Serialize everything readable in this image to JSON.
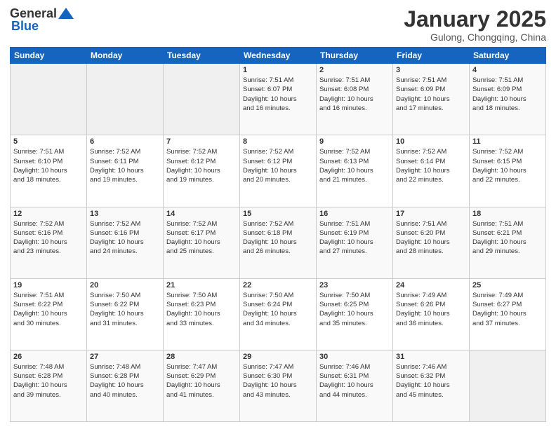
{
  "header": {
    "logo_general": "General",
    "logo_blue": "Blue",
    "month_title": "January 2025",
    "location": "Gulong, Chongqing, China"
  },
  "days_of_week": [
    "Sunday",
    "Monday",
    "Tuesday",
    "Wednesday",
    "Thursday",
    "Friday",
    "Saturday"
  ],
  "weeks": [
    [
      {
        "num": "",
        "info": ""
      },
      {
        "num": "",
        "info": ""
      },
      {
        "num": "",
        "info": ""
      },
      {
        "num": "1",
        "info": "Sunrise: 7:51 AM\nSunset: 6:07 PM\nDaylight: 10 hours\nand 16 minutes."
      },
      {
        "num": "2",
        "info": "Sunrise: 7:51 AM\nSunset: 6:08 PM\nDaylight: 10 hours\nand 16 minutes."
      },
      {
        "num": "3",
        "info": "Sunrise: 7:51 AM\nSunset: 6:09 PM\nDaylight: 10 hours\nand 17 minutes."
      },
      {
        "num": "4",
        "info": "Sunrise: 7:51 AM\nSunset: 6:09 PM\nDaylight: 10 hours\nand 18 minutes."
      }
    ],
    [
      {
        "num": "5",
        "info": "Sunrise: 7:51 AM\nSunset: 6:10 PM\nDaylight: 10 hours\nand 18 minutes."
      },
      {
        "num": "6",
        "info": "Sunrise: 7:52 AM\nSunset: 6:11 PM\nDaylight: 10 hours\nand 19 minutes."
      },
      {
        "num": "7",
        "info": "Sunrise: 7:52 AM\nSunset: 6:12 PM\nDaylight: 10 hours\nand 19 minutes."
      },
      {
        "num": "8",
        "info": "Sunrise: 7:52 AM\nSunset: 6:12 PM\nDaylight: 10 hours\nand 20 minutes."
      },
      {
        "num": "9",
        "info": "Sunrise: 7:52 AM\nSunset: 6:13 PM\nDaylight: 10 hours\nand 21 minutes."
      },
      {
        "num": "10",
        "info": "Sunrise: 7:52 AM\nSunset: 6:14 PM\nDaylight: 10 hours\nand 22 minutes."
      },
      {
        "num": "11",
        "info": "Sunrise: 7:52 AM\nSunset: 6:15 PM\nDaylight: 10 hours\nand 22 minutes."
      }
    ],
    [
      {
        "num": "12",
        "info": "Sunrise: 7:52 AM\nSunset: 6:16 PM\nDaylight: 10 hours\nand 23 minutes."
      },
      {
        "num": "13",
        "info": "Sunrise: 7:52 AM\nSunset: 6:16 PM\nDaylight: 10 hours\nand 24 minutes."
      },
      {
        "num": "14",
        "info": "Sunrise: 7:52 AM\nSunset: 6:17 PM\nDaylight: 10 hours\nand 25 minutes."
      },
      {
        "num": "15",
        "info": "Sunrise: 7:52 AM\nSunset: 6:18 PM\nDaylight: 10 hours\nand 26 minutes."
      },
      {
        "num": "16",
        "info": "Sunrise: 7:51 AM\nSunset: 6:19 PM\nDaylight: 10 hours\nand 27 minutes."
      },
      {
        "num": "17",
        "info": "Sunrise: 7:51 AM\nSunset: 6:20 PM\nDaylight: 10 hours\nand 28 minutes."
      },
      {
        "num": "18",
        "info": "Sunrise: 7:51 AM\nSunset: 6:21 PM\nDaylight: 10 hours\nand 29 minutes."
      }
    ],
    [
      {
        "num": "19",
        "info": "Sunrise: 7:51 AM\nSunset: 6:22 PM\nDaylight: 10 hours\nand 30 minutes."
      },
      {
        "num": "20",
        "info": "Sunrise: 7:50 AM\nSunset: 6:22 PM\nDaylight: 10 hours\nand 31 minutes."
      },
      {
        "num": "21",
        "info": "Sunrise: 7:50 AM\nSunset: 6:23 PM\nDaylight: 10 hours\nand 33 minutes."
      },
      {
        "num": "22",
        "info": "Sunrise: 7:50 AM\nSunset: 6:24 PM\nDaylight: 10 hours\nand 34 minutes."
      },
      {
        "num": "23",
        "info": "Sunrise: 7:50 AM\nSunset: 6:25 PM\nDaylight: 10 hours\nand 35 minutes."
      },
      {
        "num": "24",
        "info": "Sunrise: 7:49 AM\nSunset: 6:26 PM\nDaylight: 10 hours\nand 36 minutes."
      },
      {
        "num": "25",
        "info": "Sunrise: 7:49 AM\nSunset: 6:27 PM\nDaylight: 10 hours\nand 37 minutes."
      }
    ],
    [
      {
        "num": "26",
        "info": "Sunrise: 7:48 AM\nSunset: 6:28 PM\nDaylight: 10 hours\nand 39 minutes."
      },
      {
        "num": "27",
        "info": "Sunrise: 7:48 AM\nSunset: 6:28 PM\nDaylight: 10 hours\nand 40 minutes."
      },
      {
        "num": "28",
        "info": "Sunrise: 7:47 AM\nSunset: 6:29 PM\nDaylight: 10 hours\nand 41 minutes."
      },
      {
        "num": "29",
        "info": "Sunrise: 7:47 AM\nSunset: 6:30 PM\nDaylight: 10 hours\nand 43 minutes."
      },
      {
        "num": "30",
        "info": "Sunrise: 7:46 AM\nSunset: 6:31 PM\nDaylight: 10 hours\nand 44 minutes."
      },
      {
        "num": "31",
        "info": "Sunrise: 7:46 AM\nSunset: 6:32 PM\nDaylight: 10 hours\nand 45 minutes."
      },
      {
        "num": "",
        "info": ""
      }
    ]
  ]
}
